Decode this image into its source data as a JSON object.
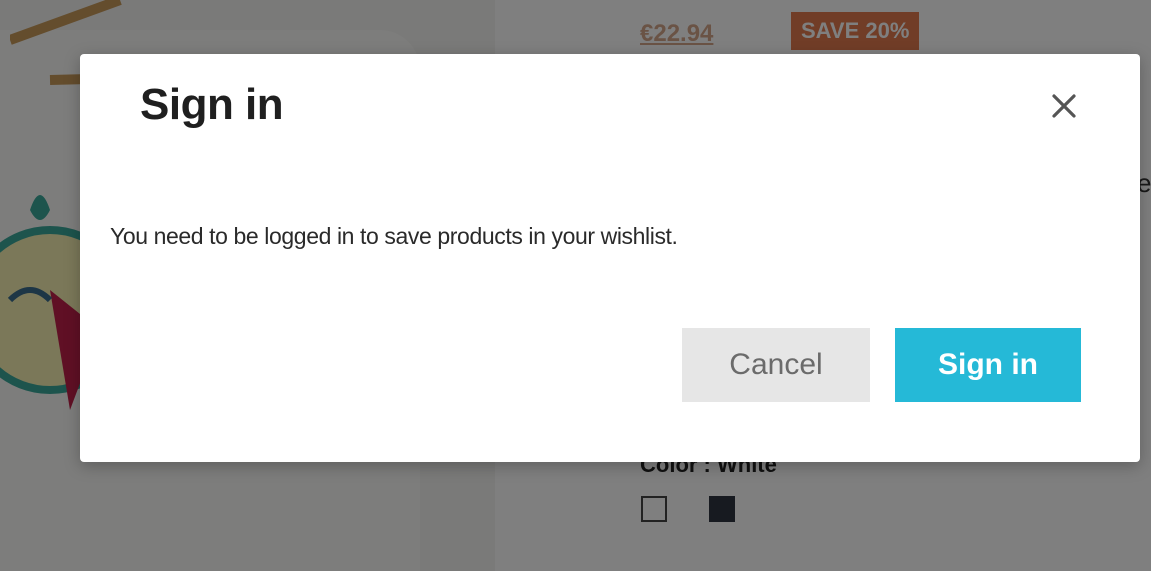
{
  "background": {
    "old_price": "€22.94",
    "save_badge": "SAVE 20%",
    "stray_letter": "e",
    "color_label": "Color : White",
    "swatches": [
      {
        "name": "white",
        "color": "#ffffff"
      },
      {
        "name": "dark",
        "color": "#2f3440"
      }
    ]
  },
  "modal": {
    "title": "Sign in",
    "close_icon": "close-icon",
    "message": "You need to be logged in to save products in your wishlist.",
    "cancel_label": "Cancel",
    "signin_label": "Sign in"
  },
  "colors": {
    "primary": "#25b9d7",
    "cancel_bg": "#e6e6e6",
    "cancel_text": "#6b6b6b",
    "badge": "#e27a4f",
    "overlay": "rgba(0,0,0,0.5)"
  }
}
